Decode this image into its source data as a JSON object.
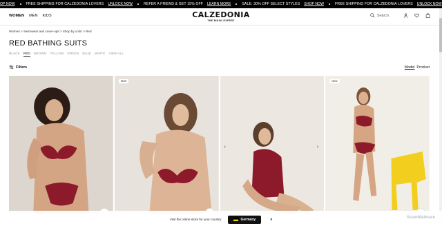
{
  "ticker": {
    "items": [
      {
        "text": "",
        "link": "OP NOW"
      },
      {
        "text": "FREE SHIPPING FOR CALZEDONIA LOVERS",
        "link": "UNLOCK NOW"
      },
      {
        "text": "REFER A FRIEND & GET 15% OFF",
        "link": "LEARN MORE"
      },
      {
        "text": "SALE: 30% OFF SELECT STYLES",
        "link": "SHOP NOW"
      },
      {
        "text": "FREE SHIPPING FOR CALZEDONIA LOVERS",
        "link": "UNLOCK NOW"
      }
    ]
  },
  "header": {
    "nav": [
      "WOMEN",
      "MEN",
      "KIDS"
    ],
    "brand": "CALZEDONIA",
    "tagline": "THE BIKINI EXPERT",
    "search_label": "Search"
  },
  "breadcrumb": "Women > Swimwear and cover-ups > Shop by color > Red",
  "title": "RED BATHING SUITS",
  "colors": [
    "BLACK",
    "RED",
    "BROWN",
    "YELLOW",
    "GREEN",
    "BLUE",
    "WHITE",
    "VIEW ALL"
  ],
  "selected_color": "RED",
  "filters_label": "Filters",
  "view": {
    "model": "Model",
    "product": "Product"
  },
  "products": [
    {
      "badge": ""
    },
    {
      "badge": "NEW"
    },
    {
      "badge": ""
    },
    {
      "badge": "NEW"
    }
  ],
  "country_bar": {
    "prompt": "Visit the online store for your country:",
    "country": "Germany",
    "close": "x"
  },
  "watermark": "ScanMalware",
  "colors_hex": {
    "accent": "#8c1a2b",
    "ticker_bg": "#000000"
  }
}
